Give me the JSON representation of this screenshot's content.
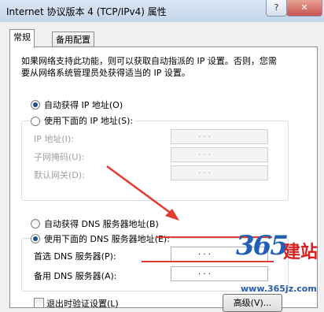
{
  "window": {
    "title": "Internet 协议版本 4 (TCP/IPv4) 属性",
    "help_label": "?",
    "close_label": "✕"
  },
  "tabs": [
    {
      "label": "常规",
      "active": true
    },
    {
      "label": "备用配置",
      "active": false
    }
  ],
  "description": "如果网络支持此功能，则可以获取自动指派的 IP 设置。否则，您需要从网络系统管理员处获得适当的 IP 设置。",
  "ip": {
    "auto_label": "自动获得 IP 地址(O)",
    "manual_label": "使用下面的 IP 地址(S):",
    "selected": "auto",
    "fields": [
      {
        "label": "IP 地址(I):",
        "value": ". . ."
      },
      {
        "label": "子网掩码(U):",
        "value": ". . ."
      },
      {
        "label": "默认网关(D):",
        "value": ". . ."
      }
    ]
  },
  "dns": {
    "auto_label": "自动获得 DNS 服务器地址(B)",
    "manual_label": "使用下面的 DNS 服务器地址(E):",
    "selected": "manual",
    "fields": [
      {
        "label": "首选 DNS 服务器(P):",
        "value": ". . ."
      },
      {
        "label": "备用 DNS 服务器(A):",
        "value": ". . ."
      }
    ]
  },
  "validate_on_exit": {
    "label": "退出时验证设置(L)",
    "checked": false
  },
  "advanced_button": "高级(V)...",
  "watermark": {
    "brand": "365",
    "brand_cn": "建站",
    "url": "www.365jz.com"
  },
  "colors": {
    "annotation": "#e33a2f",
    "radio_selected": "#1e4a8a",
    "watermark_blue": "#1f5fb5",
    "watermark_red": "#d82020"
  }
}
